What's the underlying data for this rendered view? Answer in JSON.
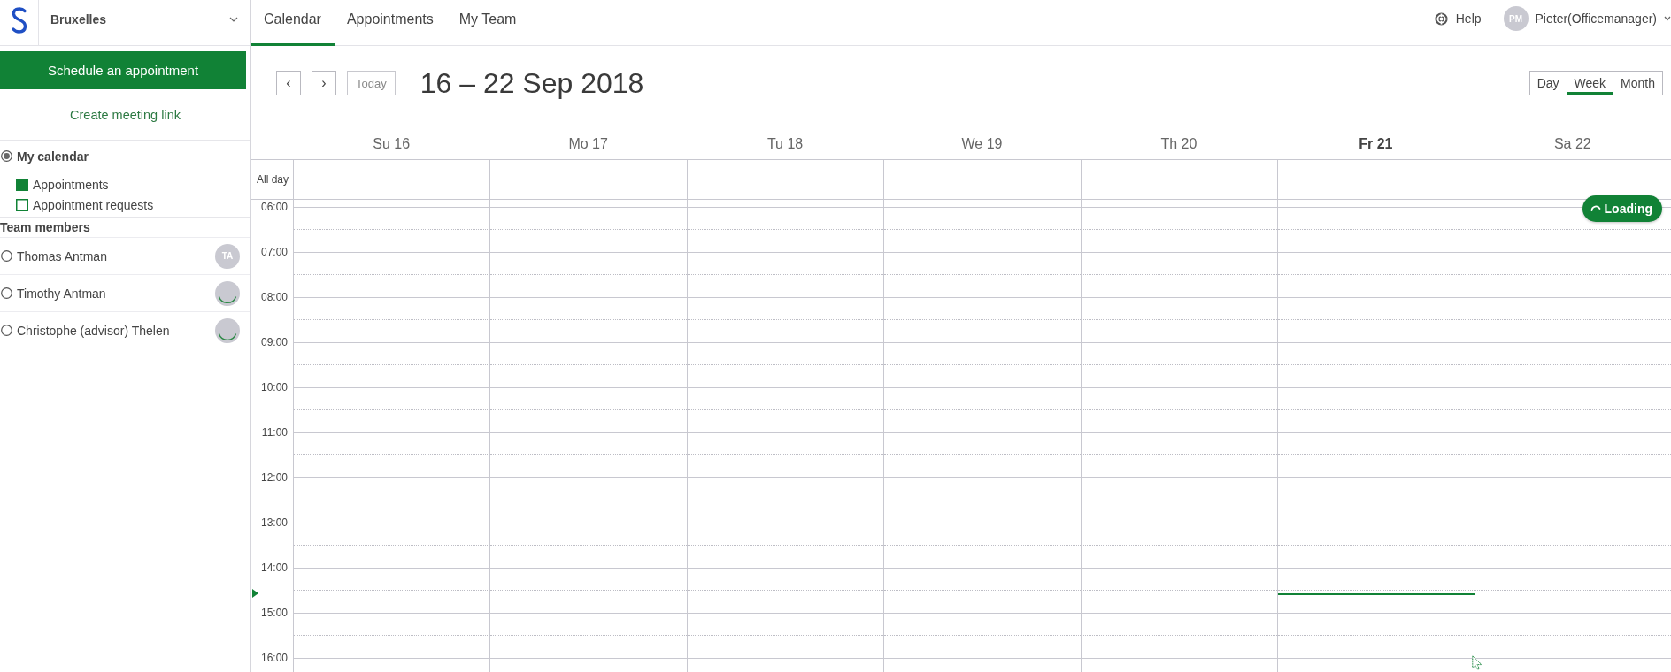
{
  "sidebar": {
    "location": "Bruxelles",
    "primary_button": "Schedule an appointment",
    "meeting_link": "Create meeting link",
    "my_calendar": {
      "label": "My calendar",
      "selected": true
    },
    "legend": [
      {
        "label": "Appointments",
        "kind": "solid"
      },
      {
        "label": "Appointment requests",
        "kind": "outline"
      }
    ],
    "team_heading": "Team members",
    "team_members": [
      {
        "name": "Thomas Antman",
        "selected": false,
        "avatar": {
          "kind": "initials",
          "text": "TA"
        }
      },
      {
        "name": "Timothy Antman",
        "selected": false,
        "avatar": {
          "kind": "loading"
        }
      },
      {
        "name": "Christophe (advisor) Thelen",
        "selected": false,
        "avatar": {
          "kind": "loading"
        }
      }
    ]
  },
  "top_nav": {
    "tabs": [
      {
        "label": "Calendar",
        "selected": true
      },
      {
        "label": "Appointments",
        "selected": false
      },
      {
        "label": "My Team",
        "selected": false
      }
    ],
    "help": "Help",
    "user": {
      "initials": "PM",
      "name": "Pieter(Officemanager)"
    }
  },
  "toolbar": {
    "prev": "‹",
    "next": "›",
    "today": {
      "label": "Today",
      "disabled": true
    },
    "title": "16 – 22 Sep 2018",
    "views": [
      {
        "label": "Day",
        "selected": false
      },
      {
        "label": "Week",
        "selected": true
      },
      {
        "label": "Month",
        "selected": false
      }
    ]
  },
  "week": {
    "days": [
      {
        "label": "Su 16",
        "today": false
      },
      {
        "label": "Mo 17",
        "today": false
      },
      {
        "label": "Tu 18",
        "today": false
      },
      {
        "label": "We 19",
        "today": false
      },
      {
        "label": "Th 20",
        "today": false
      },
      {
        "label": "Fr 21",
        "today": true
      },
      {
        "label": "Sa 22",
        "today": false
      }
    ],
    "all_day_label": "All day",
    "times": [
      "06:00",
      "07:00",
      "08:00",
      "09:00",
      "10:00",
      "11:00",
      "12:00",
      "13:00",
      "14:00",
      "15:00",
      "16:00"
    ],
    "loading_indicator": "Loading"
  }
}
